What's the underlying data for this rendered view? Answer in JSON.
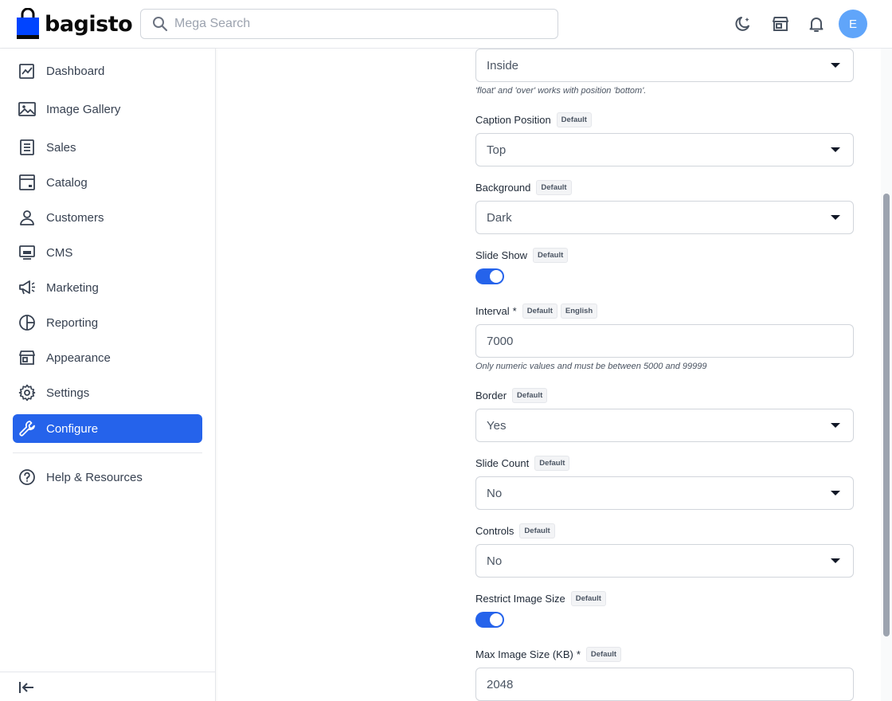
{
  "app": {
    "logo_text": "bagisto",
    "search_placeholder": "Mega Search",
    "avatar_letter": "E"
  },
  "header_icons": [
    "dark-mode-icon",
    "storefront-icon",
    "notification-bell-icon"
  ],
  "sidebar": {
    "items": [
      {
        "label": "Dashboard",
        "icon": "dashboard-icon"
      },
      {
        "label": "Image Gallery",
        "icon": "image-gallery-icon"
      },
      {
        "label": "Sales",
        "icon": "sales-icon"
      },
      {
        "label": "Catalog",
        "icon": "catalog-icon"
      },
      {
        "label": "Customers",
        "icon": "customers-icon"
      },
      {
        "label": "CMS",
        "icon": "cms-icon"
      },
      {
        "label": "Marketing",
        "icon": "marketing-icon"
      },
      {
        "label": "Reporting",
        "icon": "reporting-icon"
      },
      {
        "label": "Appearance",
        "icon": "appearance-icon"
      },
      {
        "label": "Settings",
        "icon": "settings-icon"
      },
      {
        "label": "Configure",
        "icon": "configure-icon",
        "active": true
      }
    ],
    "help_label": "Help & Resources"
  },
  "form": {
    "position_select_value": "Inside",
    "position_hint": "'float' and 'over' works with position 'bottom'.",
    "caption_position": {
      "label": "Caption Position",
      "badge": "Default",
      "value": "Top"
    },
    "background": {
      "label": "Background",
      "badge": "Default",
      "value": "Dark"
    },
    "slide_show": {
      "label": "Slide Show",
      "badge": "Default",
      "enabled": true
    },
    "interval": {
      "label": "Interval",
      "required": "*",
      "badge1": "Default",
      "badge2": "English",
      "value": "7000",
      "hint": "Only numeric values and must be between 5000 and 99999"
    },
    "border": {
      "label": "Border",
      "badge": "Default",
      "value": "Yes"
    },
    "slide_count": {
      "label": "Slide Count",
      "badge": "Default",
      "value": "No"
    },
    "controls": {
      "label": "Controls",
      "badge": "Default",
      "value": "No"
    },
    "restrict_image_size": {
      "label": "Restrict Image Size",
      "badge": "Default",
      "enabled": true
    },
    "max_image_size": {
      "label": "Max Image Size (KB)",
      "required": "*",
      "badge": "Default",
      "value": "2048"
    }
  },
  "colors": {
    "accent": "#2563eb",
    "avatar": "#60a5fa"
  }
}
